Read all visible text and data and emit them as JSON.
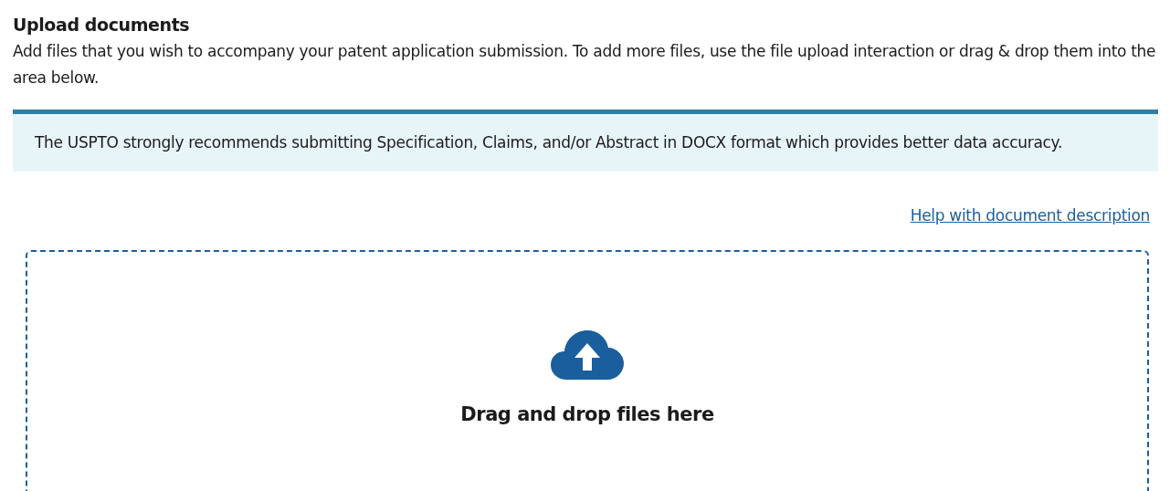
{
  "heading": "Upload documents",
  "description": "Add files that you wish to accompany your patent application submission. To add more files, use the file upload interaction or drag & drop them into the area below.",
  "alert": {
    "text": "The USPTO strongly recommends submitting Specification, Claims, and/or Abstract in DOCX format which provides better data accuracy."
  },
  "help_link": "Help with document description",
  "dropzone": {
    "label": "Drag and drop files here"
  }
}
